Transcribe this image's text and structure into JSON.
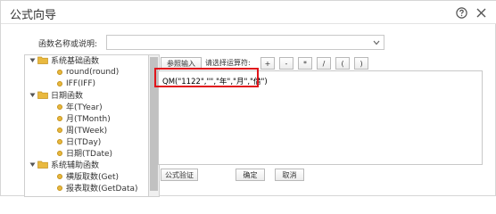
{
  "dialog": {
    "title": "公式向导"
  },
  "search": {
    "label": "函数名称或说明:",
    "value": "",
    "placeholder": ""
  },
  "tree": {
    "nodes": [
      {
        "label": "系统基础函数",
        "kind": "folder",
        "expanded": true
      },
      {
        "label": "round(round)",
        "kind": "leaf"
      },
      {
        "label": "IFF(IFF)",
        "kind": "leaf"
      },
      {
        "label": "日期函数",
        "kind": "folder",
        "expanded": true
      },
      {
        "label": "年(TYear)",
        "kind": "leaf"
      },
      {
        "label": "月(TMonth)",
        "kind": "leaf"
      },
      {
        "label": "周(TWeek)",
        "kind": "leaf"
      },
      {
        "label": "日(TDay)",
        "kind": "leaf"
      },
      {
        "label": "日期(TDate)",
        "kind": "leaf"
      },
      {
        "label": "系统辅助函数",
        "kind": "folder",
        "expanded": true
      },
      {
        "label": "横版取数(Get)",
        "kind": "leaf"
      },
      {
        "label": "报表取数(GetData)",
        "kind": "leaf"
      }
    ]
  },
  "toolbar": {
    "ref_input_label": "参照输入",
    "operator_label": "请选择运算符:",
    "operators": [
      "+",
      "-",
      "*",
      "/",
      "(",
      ")"
    ]
  },
  "editor": {
    "formula": "QM(\"1122\",\"\",\"年\",\"月\",\"借\")"
  },
  "footer": {
    "validate_label": "公式验证",
    "ok_label": "确定",
    "cancel_label": "取消"
  },
  "colors": {
    "highlight": "#e0141b",
    "folder": "#e9b93f",
    "leaf_dot": "#e8b83e"
  }
}
